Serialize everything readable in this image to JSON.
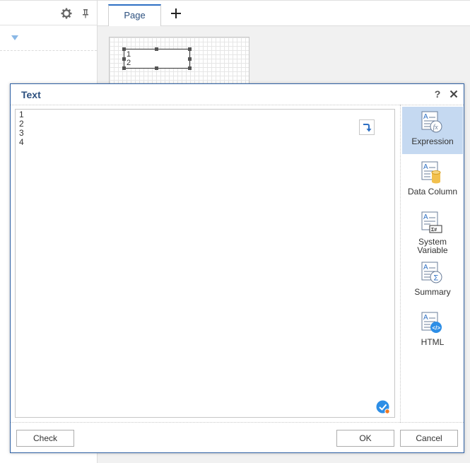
{
  "designer": {
    "tab_label": "Page",
    "component_lines": [
      "1",
      "2"
    ]
  },
  "dialog": {
    "title": "Text",
    "help_label": "?",
    "editor_lines": [
      "1",
      "2",
      "3",
      "4"
    ],
    "sidebar": {
      "items": [
        {
          "label": "Expression",
          "icon": "expression-icon",
          "active": true
        },
        {
          "label": "Data Column",
          "icon": "data-column-icon",
          "active": false
        },
        {
          "label": "System Variable",
          "icon": "system-variable-icon",
          "active": false
        },
        {
          "label": "Summary",
          "icon": "summary-icon",
          "active": false
        },
        {
          "label": "HTML",
          "icon": "html-icon",
          "active": false
        }
      ]
    },
    "footer": {
      "check_label": "Check",
      "ok_label": "OK",
      "cancel_label": "Cancel"
    }
  },
  "colors": {
    "accent": "#2d6fc3",
    "title_text": "#2b4f7e",
    "active_item_bg": "#c5d9f1",
    "check_badge": "#2d8ee6",
    "badge_dot": "#f07820"
  }
}
